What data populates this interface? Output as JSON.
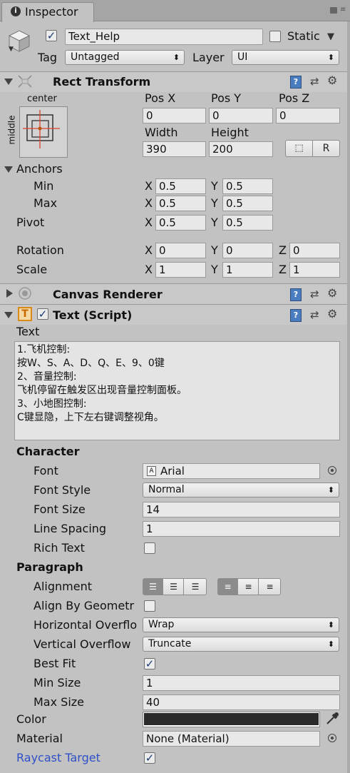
{
  "tab": {
    "title": "Inspector"
  },
  "object": {
    "name": "Text_Help",
    "active": true,
    "static_label": "Static",
    "tag_label": "Tag",
    "tag_value": "Untagged",
    "layer_label": "Layer",
    "layer_value": "UI"
  },
  "rect_transform": {
    "title": "Rect Transform",
    "anchor_h": "center",
    "anchor_v": "middle",
    "pos_x_label": "Pos X",
    "pos_y_label": "Pos Y",
    "pos_z_label": "Pos Z",
    "pos_x": "0",
    "pos_y": "0",
    "pos_z": "0",
    "width_label": "Width",
    "height_label": "Height",
    "width": "390",
    "height": "200",
    "r_button": "R",
    "anchors_label": "Anchors",
    "min_label": "Min",
    "max_label": "Max",
    "min_x": "0.5",
    "min_y": "0.5",
    "max_x": "0.5",
    "max_y": "0.5",
    "pivot_label": "Pivot",
    "pivot_x": "0.5",
    "pivot_y": "0.5",
    "rotation_label": "Rotation",
    "rot_x": "0",
    "rot_y": "0",
    "rot_z": "0",
    "scale_label": "Scale",
    "scale_x": "1",
    "scale_y": "1",
    "scale_z": "1",
    "x": "X",
    "y": "Y",
    "z": "Z"
  },
  "canvas_renderer": {
    "title": "Canvas Renderer"
  },
  "text_script": {
    "title": "Text (Script)",
    "text_label": "Text",
    "text_lines": [
      "1.飞机控制:",
      "按W、S、A、D、Q、E、9、0键",
      "2、音量控制:",
      "飞机停留在触发区出现音量控制面板。",
      "3、小地图控制:",
      "C键显隐，上下左右键调整视角。"
    ],
    "character_label": "Character",
    "font_label": "Font",
    "font_value": "Arial",
    "font_style_label": "Font Style",
    "font_style_value": "Normal",
    "font_size_label": "Font Size",
    "font_size_value": "14",
    "line_spacing_label": "Line Spacing",
    "line_spacing_value": "1",
    "rich_text_label": "Rich Text",
    "rich_text": false,
    "paragraph_label": "Paragraph",
    "alignment_label": "Alignment",
    "align_by_geometry_label": "Align By Geometr",
    "align_by_geometry": false,
    "h_overflow_label": "Horizontal Overflo",
    "h_overflow_value": "Wrap",
    "v_overflow_label": "Vertical Overflow",
    "v_overflow_value": "Truncate",
    "best_fit_label": "Best Fit",
    "best_fit": true,
    "min_size_label": "Min Size",
    "min_size_value": "1",
    "max_size_label": "Max Size",
    "max_size_value": "40",
    "color_label": "Color",
    "color_value": "#2b2b2b",
    "material_label": "Material",
    "material_value": "None (Material)",
    "raycast_label": "Raycast Target",
    "raycast": true
  },
  "colors": {
    "panel_bg": "#c2c2c2",
    "field_bg": "#e8e8e8",
    "link_blue": "#2f4fc8",
    "check_blue": "#1a3a73"
  }
}
